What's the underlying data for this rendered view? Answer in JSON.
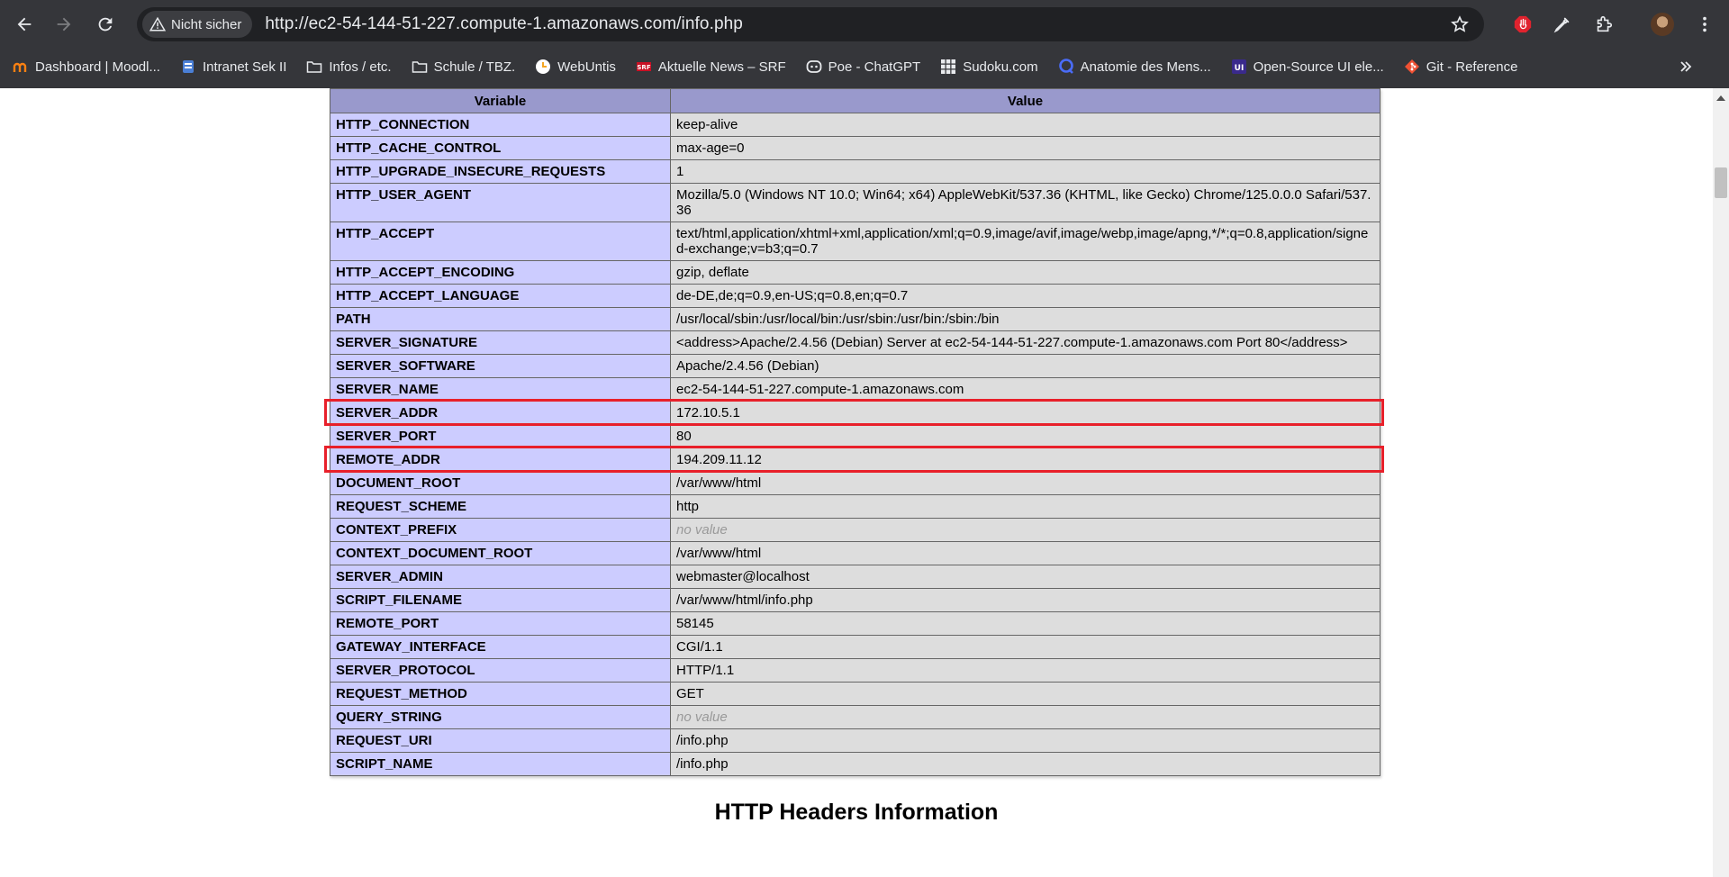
{
  "browser": {
    "security_label": "Nicht sicher",
    "url": "http://ec2-54-144-51-227.compute-1.amazonaws.com/info.php",
    "bookmarks": [
      {
        "label": "Dashboard | Moodl...",
        "icon": "moodle-icon"
      },
      {
        "label": "Intranet Sek II",
        "icon": "intranet-icon"
      },
      {
        "label": "Infos / etc.",
        "icon": "folder-icon"
      },
      {
        "label": "Schule / TBZ.",
        "icon": "folder-icon"
      },
      {
        "label": "WebUntis",
        "icon": "webuntis-icon"
      },
      {
        "label": "Aktuelle News – SRF",
        "icon": "srf-icon"
      },
      {
        "label": "Poe - ChatGPT",
        "icon": "poe-icon"
      },
      {
        "label": "Sudoku.com",
        "icon": "sudoku-icon"
      },
      {
        "label": "Anatomie des Mens...",
        "icon": "anatomy-icon"
      },
      {
        "label": "Open-Source UI ele...",
        "icon": "ui-icon"
      },
      {
        "label": "Git - Reference",
        "icon": "git-icon"
      }
    ]
  },
  "table": {
    "headers": [
      "Variable",
      "Value"
    ],
    "rows": [
      {
        "name": "HTTP_CONNECTION",
        "value": "keep-alive"
      },
      {
        "name": "HTTP_CACHE_CONTROL",
        "value": "max-age=0"
      },
      {
        "name": "HTTP_UPGRADE_INSECURE_REQUESTS",
        "value": "1"
      },
      {
        "name": "HTTP_USER_AGENT",
        "value": "Mozilla/5.0 (Windows NT 10.0; Win64; x64) AppleWebKit/537.36 (KHTML, like Gecko) Chrome/125.0.0.0 Safari/537.36"
      },
      {
        "name": "HTTP_ACCEPT",
        "value": "text/html,application/xhtml+xml,application/xml;q=0.9,image/avif,image/webp,image/apng,*/*;q=0.8,application/signed-exchange;v=b3;q=0.7"
      },
      {
        "name": "HTTP_ACCEPT_ENCODING",
        "value": "gzip, deflate"
      },
      {
        "name": "HTTP_ACCEPT_LANGUAGE",
        "value": "de-DE,de;q=0.9,en-US;q=0.8,en;q=0.7"
      },
      {
        "name": "PATH",
        "value": "/usr/local/sbin:/usr/local/bin:/usr/sbin:/usr/bin:/sbin:/bin"
      },
      {
        "name": "SERVER_SIGNATURE",
        "value": "<address>Apache/2.4.56 (Debian) Server at ec2-54-144-51-227.compute-1.amazonaws.com Port 80</address>"
      },
      {
        "name": "SERVER_SOFTWARE",
        "value": "Apache/2.4.56 (Debian)"
      },
      {
        "name": "SERVER_NAME",
        "value": "ec2-54-144-51-227.compute-1.amazonaws.com"
      },
      {
        "name": "SERVER_ADDR",
        "value": "172.10.5.1",
        "highlighted": true
      },
      {
        "name": "SERVER_PORT",
        "value": "80"
      },
      {
        "name": "REMOTE_ADDR",
        "value": "194.209.11.12",
        "highlighted": true
      },
      {
        "name": "DOCUMENT_ROOT",
        "value": "/var/www/html"
      },
      {
        "name": "REQUEST_SCHEME",
        "value": "http"
      },
      {
        "name": "CONTEXT_PREFIX",
        "value": "no value",
        "empty": true
      },
      {
        "name": "CONTEXT_DOCUMENT_ROOT",
        "value": "/var/www/html"
      },
      {
        "name": "SERVER_ADMIN",
        "value": "webmaster@localhost"
      },
      {
        "name": "SCRIPT_FILENAME",
        "value": "/var/www/html/info.php"
      },
      {
        "name": "REMOTE_PORT",
        "value": "58145"
      },
      {
        "name": "GATEWAY_INTERFACE",
        "value": "CGI/1.1"
      },
      {
        "name": "SERVER_PROTOCOL",
        "value": "HTTP/1.1"
      },
      {
        "name": "REQUEST_METHOD",
        "value": "GET"
      },
      {
        "name": "QUERY_STRING",
        "value": "no value",
        "empty": true
      },
      {
        "name": "REQUEST_URI",
        "value": "/info.php"
      },
      {
        "name": "SCRIPT_NAME",
        "value": "/info.php"
      }
    ]
  },
  "section_heading": "HTTP Headers Information",
  "colors": {
    "highlight": "#e8202a",
    "header_bg": "#9999cc",
    "name_cell_bg": "#ccccff",
    "value_cell_bg": "#dddddd"
  }
}
